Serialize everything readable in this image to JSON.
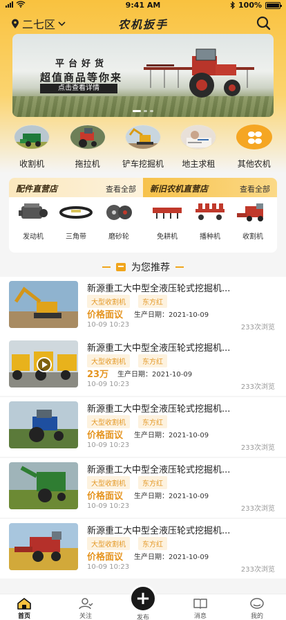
{
  "status_bar": {
    "time": "9:41 AM",
    "battery": "100%"
  },
  "header": {
    "location": "二七区",
    "title": "农机扳手"
  },
  "banner": {
    "line1": "平台好货",
    "line2": "超值商品等你来",
    "cta": "点击查看详情"
  },
  "categories": [
    {
      "label": "收割机",
      "icon": "harvester-icon"
    },
    {
      "label": "拖拉机",
      "icon": "tractor-icon"
    },
    {
      "label": "铲车挖掘机",
      "icon": "excavator-icon"
    },
    {
      "label": "地主求租",
      "icon": "landlord-icon"
    },
    {
      "label": "其他农机",
      "icon": "other-machines-icon"
    }
  ],
  "stores": {
    "parts": {
      "title": "配件直营店",
      "all": "查看全部",
      "items": [
        {
          "label": "发动机",
          "icon": "engine-icon"
        },
        {
          "label": "三角带",
          "icon": "v-belt-icon"
        },
        {
          "label": "磨砂轮",
          "icon": "grinding-wheel-icon"
        }
      ]
    },
    "machines": {
      "title": "新旧农机直营店",
      "all": "查看全部",
      "items": [
        {
          "label": "免耕机",
          "icon": "no-till-icon"
        },
        {
          "label": "播种机",
          "icon": "seeder-icon"
        },
        {
          "label": "收割机",
          "icon": "harvester-icon"
        }
      ]
    }
  },
  "recommend": {
    "title": "为您推荐",
    "items": [
      {
        "title": "新源重工大中型全液压轮式挖掘机...",
        "tags": [
          "大型收割机",
          "东方红"
        ],
        "price": "价格面议",
        "date_label": "生产日期：",
        "date": "2021-10-09",
        "time": "10-09 10:23",
        "views": "233次浏览",
        "thumb": "excavator"
      },
      {
        "title": "新源重工大中型全液压轮式挖掘机...",
        "tags": [
          "大型收割机",
          "东方红"
        ],
        "price": "23万",
        "date_label": "生产日期：",
        "date": "2021-10-09",
        "time": "10-09 10:23",
        "views": "233次浏览",
        "thumb": "loaders"
      },
      {
        "title": "新源重工大中型全液压轮式挖掘机...",
        "tags": [
          "大型收割机",
          "东方红"
        ],
        "price": "价格面议",
        "date_label": "生产日期：",
        "date": "2021-10-09",
        "time": "10-09 10:23",
        "views": "233次浏览",
        "thumb": "blue-tractor"
      },
      {
        "title": "新源重工大中型全液压轮式挖掘机...",
        "tags": [
          "大型收割机",
          "东方红"
        ],
        "price": "价格面议",
        "date_label": "生产日期：",
        "date": "2021-10-09",
        "time": "10-09 10:23",
        "views": "233次浏览",
        "thumb": "green-harvester"
      },
      {
        "title": "新源重工大中型全液压轮式挖掘机...",
        "tags": [
          "大型收割机",
          "东方红"
        ],
        "price": "价格面议",
        "date_label": "生产日期：",
        "date": "2021-10-09",
        "time": "10-09 10:23",
        "views": "233次浏览",
        "thumb": "red-combine"
      }
    ]
  },
  "tabs": [
    {
      "label": "首页",
      "icon": "home-icon",
      "active": true
    },
    {
      "label": "关注",
      "icon": "follow-icon",
      "active": false
    },
    {
      "label": "发布",
      "icon": "publish-icon",
      "active": false
    },
    {
      "label": "消息",
      "icon": "message-icon",
      "active": false
    },
    {
      "label": "我的",
      "icon": "profile-icon",
      "active": false
    }
  ],
  "colors": {
    "accent": "#f9c23f",
    "price": "#e59420",
    "tag": "#e49a2a"
  }
}
